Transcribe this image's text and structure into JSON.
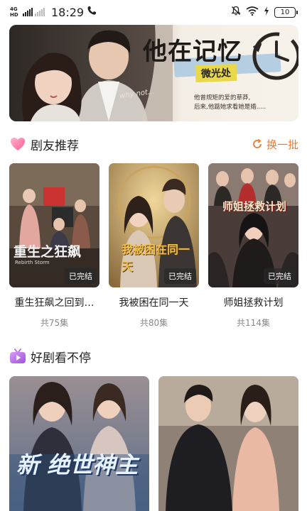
{
  "status_bar": {
    "network": "4G HD",
    "time": "18:29",
    "battery": "10"
  },
  "banner": {
    "title": "他在记忆",
    "subtitle": "微光处",
    "decor_text": "why not...",
    "description_line1": "他曾规矩的爱的草莽,",
    "description_line2": "后来,他踮她求看她是婚....."
  },
  "recommend": {
    "title": "剧友推荐",
    "refresh_label": "换一批",
    "icon": "heart-icon",
    "accent": "#f07a2a",
    "items": [
      {
        "title": "重生狂飙之回到…",
        "episodes": "共75集",
        "badge": "已完结",
        "poster_text_1": "重生之狂飙",
        "poster_text_2": "Rebirth Storm"
      },
      {
        "title": "我被困在同一天",
        "episodes": "共80集",
        "badge": "已完结",
        "poster_text_1": "我被困在同一天"
      },
      {
        "title": "师姐拯救计划",
        "episodes": "共114集",
        "badge": "已完结",
        "poster_text_1": "师姐拯救计划"
      }
    ]
  },
  "nonstop": {
    "title": "好剧看不停",
    "icon": "tv-icon",
    "items": [
      {
        "poster_text": "新 绝世神主"
      },
      {
        "poster_text": ""
      }
    ]
  }
}
